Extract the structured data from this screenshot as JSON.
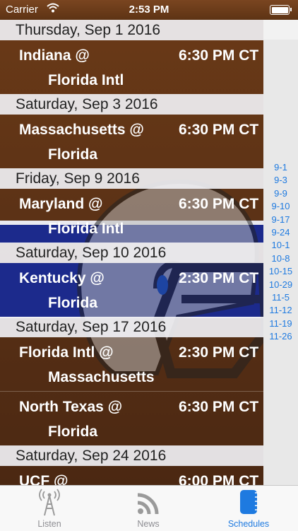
{
  "status_bar": {
    "carrier": "Carrier",
    "time": "2:53 PM"
  },
  "sections": [
    {
      "date": "Thursday, Sep 1 2016",
      "games": [
        {
          "away": "Indiana @",
          "home": "Florida Intl",
          "time": "6:30 PM CT"
        }
      ]
    },
    {
      "date": "Saturday, Sep 3 2016",
      "games": [
        {
          "away": "Massachusetts @",
          "home": "Florida",
          "time": "6:30 PM CT"
        }
      ]
    },
    {
      "date": "Friday, Sep 9 2016",
      "games": [
        {
          "away": "Maryland @",
          "home": "Florida Intl",
          "time": "6:30 PM CT"
        }
      ]
    },
    {
      "date": "Saturday, Sep 10 2016",
      "games": [
        {
          "away": "Kentucky @",
          "home": "Florida",
          "time": "2:30 PM CT"
        }
      ]
    },
    {
      "date": "Saturday, Sep 17 2016",
      "games": [
        {
          "away": "Florida Intl @",
          "home": "Massachusetts",
          "time": "2:30 PM CT"
        },
        {
          "away": "North Texas @",
          "home": "Florida",
          "time": "6:30 PM CT"
        }
      ]
    },
    {
      "date": "Saturday, Sep 24 2016",
      "games": [
        {
          "away": "UCF @",
          "home": "",
          "time": "6:00 PM CT"
        }
      ]
    }
  ],
  "index_bar": [
    "9-1",
    "9-3",
    "9-9",
    "9-10",
    "9-17",
    "9-24",
    "10-1",
    "10-8",
    "10-15",
    "10-29",
    "11-5",
    "11-12",
    "11-19",
    "11-26"
  ],
  "tabs": [
    {
      "label": "Listen",
      "icon": "radio-tower-icon",
      "active": false
    },
    {
      "label": "News",
      "icon": "rss-icon",
      "active": false
    },
    {
      "label": "Schedules",
      "icon": "schedule-book-icon",
      "active": true
    }
  ],
  "colors": {
    "accent": "#1e7ae0",
    "row_brown": "#5a3116",
    "blue_band": "#1c2a8c"
  }
}
